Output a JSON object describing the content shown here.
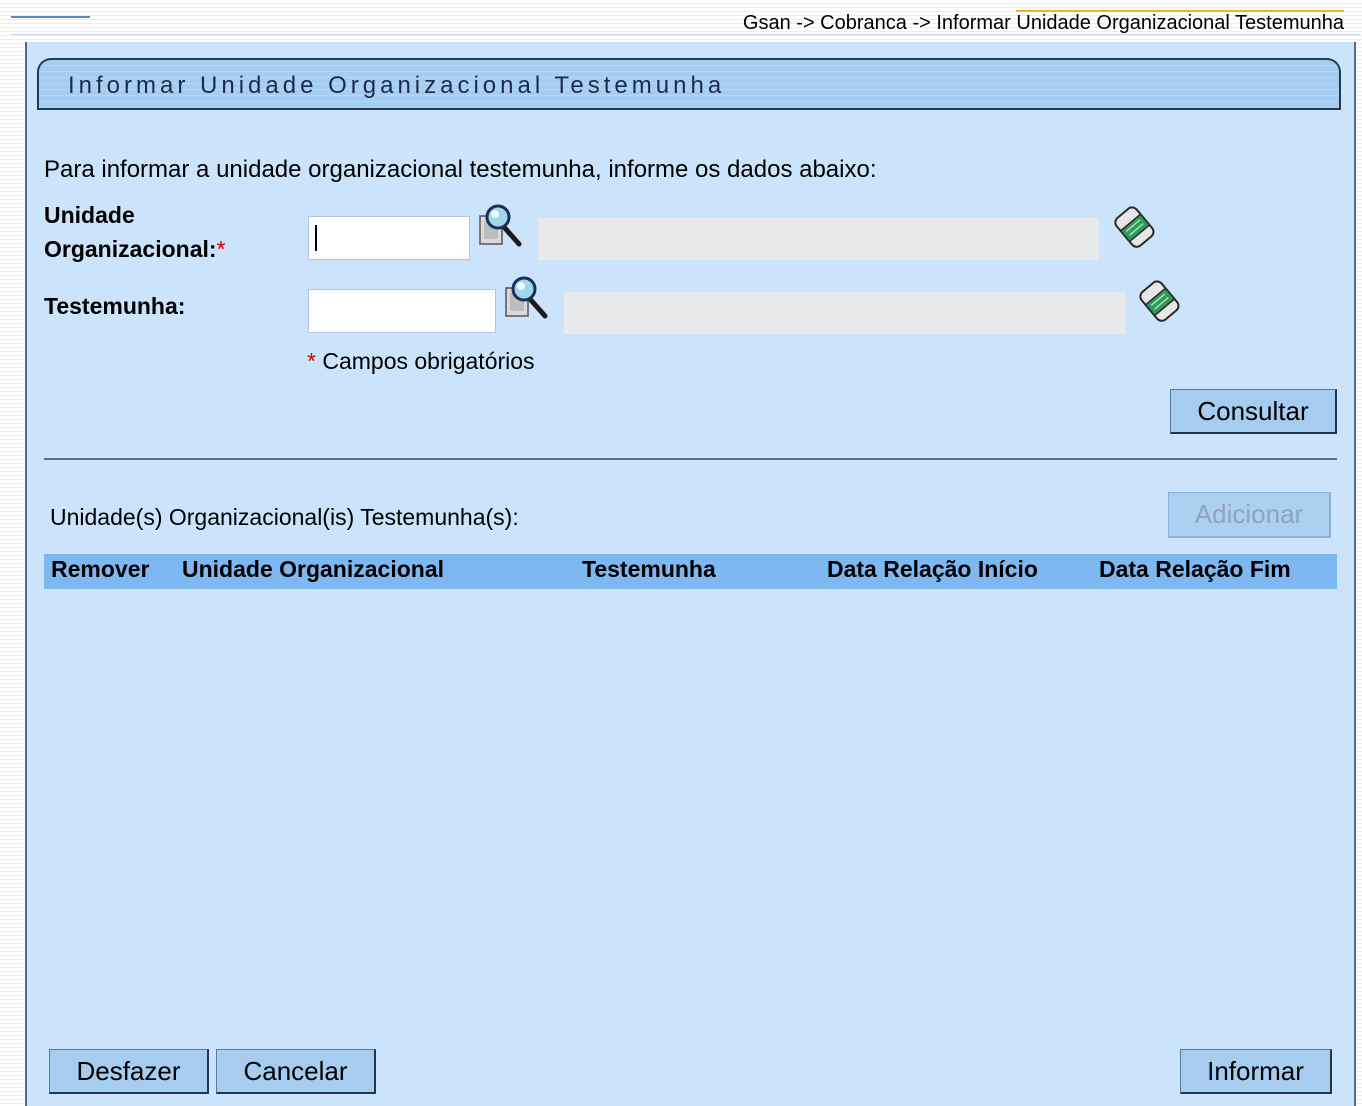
{
  "breadcrumb": {
    "prefix": "Gsan -> Cobranca -> Informar ",
    "highlight": "Unidade Organizacional Testemunha"
  },
  "title": "Informar Unidade Organizacional Testemunha",
  "instructions": "Para informar a unidade organizacional testemunha, informe os dados abaixo:",
  "form": {
    "unidade_label_line1": "Unidade",
    "unidade_label_line2": "Organizacional:",
    "required_mark": "*",
    "unidade_value": "",
    "unidade_desc": "",
    "testemunha_label": "Testemunha:",
    "testemunha_value": "",
    "testemunha_desc": ""
  },
  "required_note": {
    "mark": "*",
    "text": " Campos obrigatórios"
  },
  "buttons": {
    "consultar": "Consultar",
    "adicionar": "Adicionar",
    "desfazer": "Desfazer",
    "cancelar": "Cancelar",
    "informar": "Informar"
  },
  "list": {
    "label": "Unidade(s) Organizacional(is) Testemunha(s):",
    "columns": [
      "Remover",
      "Unidade Organizacional",
      "Testemunha",
      "Data Relação Início",
      "Data Relação Fim"
    ],
    "rows": []
  },
  "icons": {
    "search": "search-magnifier-icon",
    "clear": "eraser-icon"
  },
  "colors": {
    "panel_bg": "#cbe4fb",
    "header_row_bg": "#7db8f2",
    "button_bg": "#a6cdf0",
    "required": "#d40000"
  }
}
